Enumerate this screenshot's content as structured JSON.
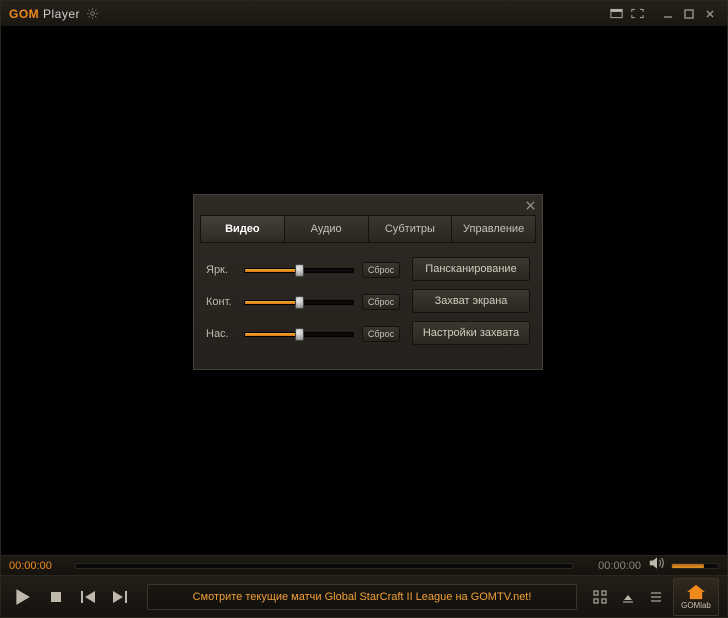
{
  "app": {
    "logo_bold": "GOM",
    "logo_rest": "Player"
  },
  "player": {
    "time_elapsed": "00:00:00",
    "time_total": "00:00:00",
    "banner_text": "Смотрите текущие матчи Global StarCraft II League на GOMTV.net!"
  },
  "gomlab": {
    "label": "GOMlab"
  },
  "panel": {
    "tabs": {
      "video": "Видео",
      "audio": "Аудио",
      "subs": "Субтитры",
      "control": "Управление"
    },
    "sliders": {
      "brightness": {
        "label": "Ярк.",
        "percent": 50
      },
      "contrast": {
        "label": "Конт.",
        "percent": 50
      },
      "saturation": {
        "label": "Нас.",
        "percent": 50
      }
    },
    "reset_label": "Сброс",
    "side_buttons": {
      "panscan": "Пансканирование",
      "capture": "Захват экрана",
      "capture_settings": "Настройки захвата"
    }
  }
}
